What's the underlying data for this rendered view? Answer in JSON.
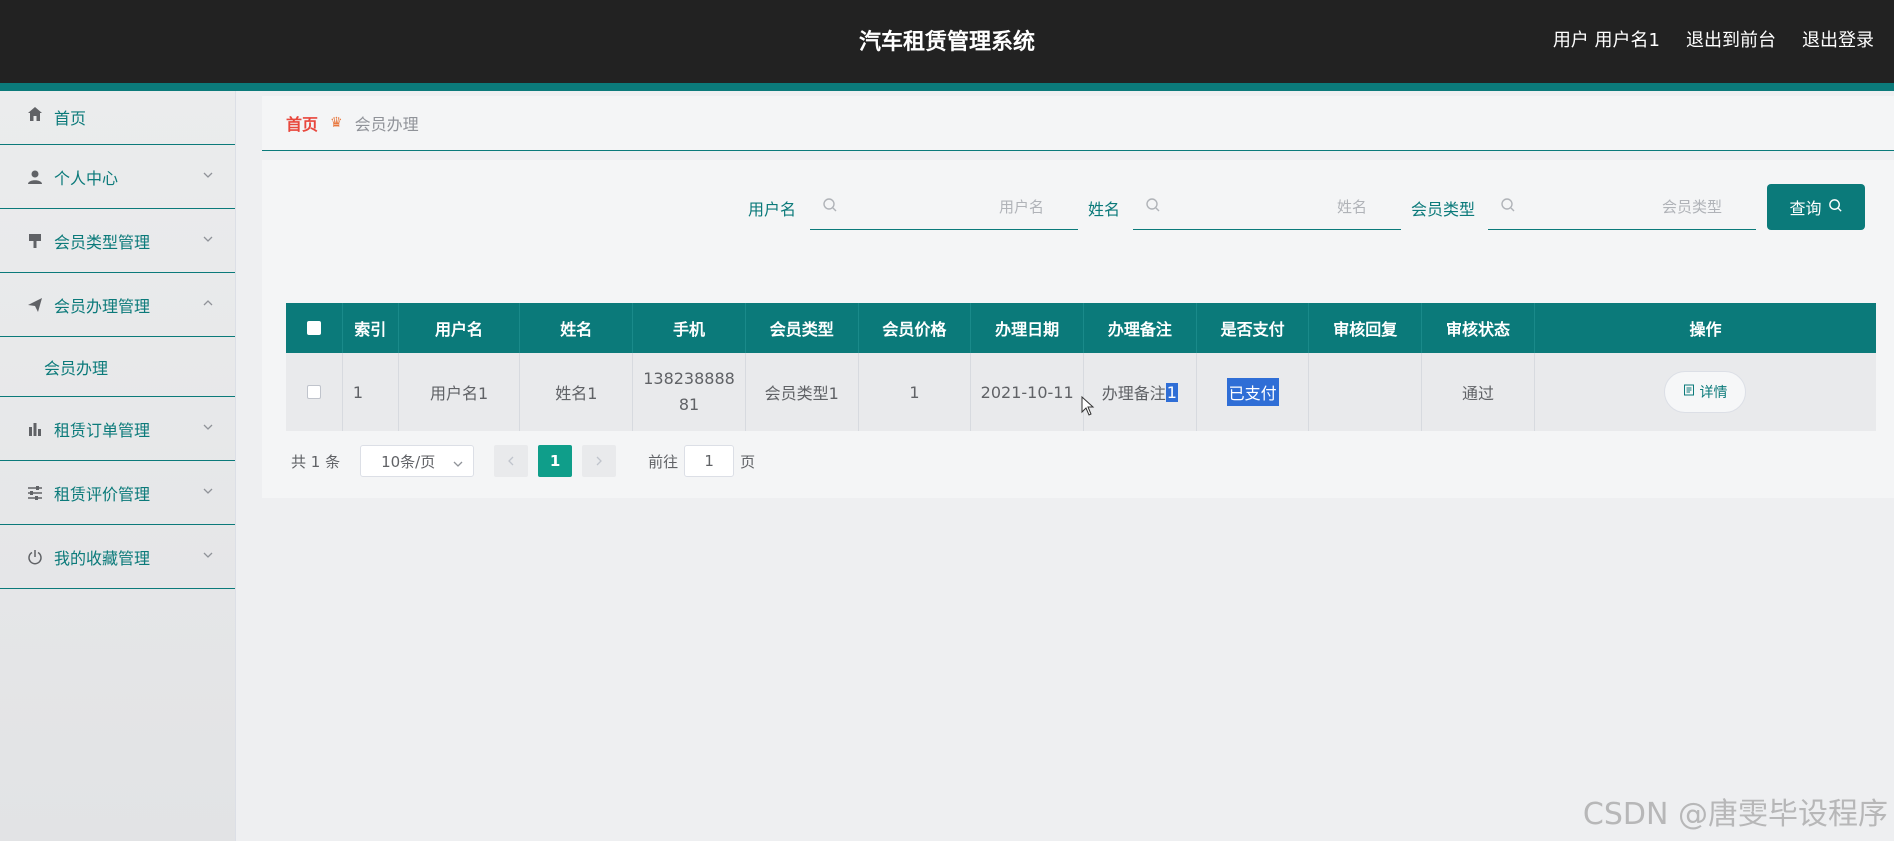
{
  "header": {
    "title": "汽车租赁管理系统",
    "user_label": "用户 用户名1",
    "to_front": "退出到前台",
    "logout": "退出登录"
  },
  "sidebar": {
    "items": [
      {
        "label": "首页",
        "icon": "home-icon"
      },
      {
        "label": "个人中心",
        "icon": "person-icon"
      },
      {
        "label": "会员类型管理",
        "icon": "brush-icon"
      },
      {
        "label": "会员办理管理",
        "icon": "send-icon"
      },
      {
        "label": "租赁订单管理",
        "icon": "bar-chart-icon"
      },
      {
        "label": "租赁评价管理",
        "icon": "sliders-icon"
      },
      {
        "label": "我的收藏管理",
        "icon": "power-icon"
      }
    ],
    "sub_item": "会员办理"
  },
  "breadcrumb": {
    "home": "首页",
    "current": "会员办理"
  },
  "search": {
    "username_label": "用户名",
    "username_placeholder": "用户名",
    "name_label": "姓名",
    "name_placeholder": "姓名",
    "type_label": "会员类型",
    "type_placeholder": "会员类型",
    "query_button": "查询"
  },
  "table": {
    "columns": [
      "索引",
      "用户名",
      "姓名",
      "手机",
      "会员类型",
      "会员价格",
      "办理日期",
      "办理备注",
      "是否支付",
      "审核回复",
      "审核状态",
      "操作"
    ],
    "rows": [
      {
        "index": "1",
        "username": "用户名1",
        "name": "姓名1",
        "phone_line1": "138238888",
        "phone_line2": "81",
        "member_type": "会员类型1",
        "price": "1",
        "date": "2021-10-11",
        "remark_prefix": "办理备注",
        "remark_suffix": "1",
        "paid": "已支付",
        "reply": "",
        "status": "通过",
        "action": "详情"
      }
    ]
  },
  "pagination": {
    "total": "共 1 条",
    "page_size": "10条/页",
    "current_page": "1",
    "goto_label": "前往",
    "goto_value": "1",
    "page_suffix": "页"
  },
  "watermark": "CSDN @唐雯毕设程序",
  "colors": {
    "primary": "#0b7a7a",
    "header_bg": "#222222",
    "breadcrumb_home": "#e8473d",
    "page_active": "#0f9e8a",
    "selection": "#2f6ed6"
  }
}
